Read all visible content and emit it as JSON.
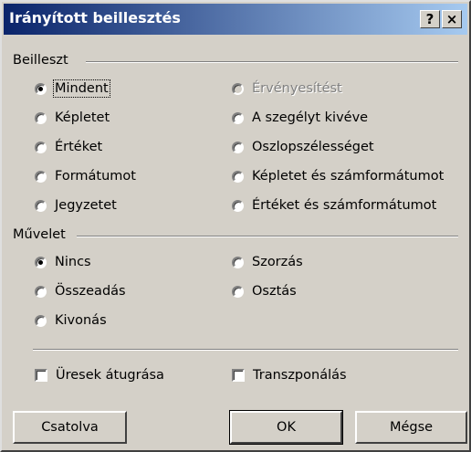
{
  "window": {
    "title": "Irányított beillesztés",
    "help_glyph": "?",
    "close_glyph": "×"
  },
  "paste_group": {
    "label": "Beilleszt",
    "options": [
      {
        "label": "Mindent",
        "checked": true,
        "disabled": false
      },
      {
        "label": "Képletet",
        "checked": false,
        "disabled": false
      },
      {
        "label": "Értéket",
        "checked": false,
        "disabled": false
      },
      {
        "label": "Formátumot",
        "checked": false,
        "disabled": false
      },
      {
        "label": "Jegyzetet",
        "checked": false,
        "disabled": false
      },
      {
        "label": "Érvényesítést",
        "checked": false,
        "disabled": true
      },
      {
        "label": "A szegélyt kivéve",
        "checked": false,
        "disabled": false
      },
      {
        "label": "Oszlopszélességet",
        "checked": false,
        "disabled": false
      },
      {
        "label": "Képletet és számformátumot",
        "checked": false,
        "disabled": false
      },
      {
        "label": "Értéket és számformátumot",
        "checked": false,
        "disabled": false
      }
    ]
  },
  "operation_group": {
    "label": "Művelet",
    "options": [
      {
        "label": "Nincs",
        "checked": true
      },
      {
        "label": "Összeadás",
        "checked": false
      },
      {
        "label": "Kivonás",
        "checked": false
      },
      {
        "label": "Szorzás",
        "checked": false
      },
      {
        "label": "Osztás",
        "checked": false
      }
    ]
  },
  "checkboxes": {
    "skip_blanks": {
      "label": "Üresek átugrása",
      "checked": false
    },
    "transpose": {
      "label": "Transzponálás",
      "checked": false
    }
  },
  "buttons": {
    "paste_link": "Csatolva",
    "ok": "OK",
    "cancel": "Mégse"
  }
}
